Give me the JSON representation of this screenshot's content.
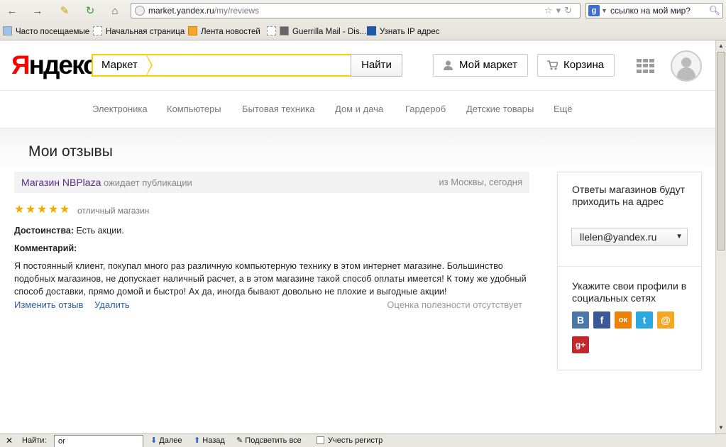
{
  "browser": {
    "url_host": "market.yandex.ru",
    "url_path": "/my/reviews",
    "search_value": "ссылко на мой мир?",
    "search_engine_icon": "google-icon",
    "bookmarks": [
      {
        "label": "Часто посещаемые",
        "icon": "search-icon"
      },
      {
        "label": "Начальная страница",
        "icon": "page-icon"
      },
      {
        "label": "Лента новостей",
        "icon": "rss-icon"
      },
      {
        "label": "Guerrilla Mail - Dis...",
        "icon": "page-icon"
      },
      {
        "label": "Узнать IP адрес",
        "icon": "ip-icon"
      }
    ]
  },
  "header": {
    "logo_first": "Я",
    "logo_rest": "ндекс",
    "search_tag": "Маркет",
    "search_button": "Найти",
    "my_market": "Мой маркет",
    "cart": "Корзина"
  },
  "categories": [
    "Электроника",
    "Компьютеры",
    "Бытовая техника",
    "Дом и дача",
    "Гардероб",
    "Детские товары",
    "Ещё"
  ],
  "page": {
    "title": "Мои отзывы"
  },
  "review": {
    "shop": "Магазин NBPlaza",
    "status": "ожидает публикации",
    "location_time": "из Москвы, сегодня",
    "rating": 5,
    "rating_max": 5,
    "rating_text": "отличный магазин",
    "pros_label": "Достоинства:",
    "pros": "Есть акции.",
    "comment_label": "Комментарий:",
    "comment": "Я постоянный клиент, покупал много раз различную компьютерную технику в этом интернет магазине. Большинство подобных магазинов, не допускает наличный расчет, а в этом магазине такой способ оплаты имеется! К тому же удобный способ доставки, прямо домой и быстро! Ах да, иногда бывают довольно не плохие и выгодные акции!",
    "edit": "Изменить отзыв",
    "delete": "Удалить",
    "usefulness": "Оценка полезности отсутствует"
  },
  "sidebar": {
    "answers_text": "Ответы магазинов будут приходить на адрес",
    "email": "llelen@yandex.ru",
    "social_text": "Укажите свои профили в социальных сетях",
    "socials": [
      {
        "label": "В",
        "color": "#4a76a8"
      },
      {
        "label": "f",
        "color": "#3b5998"
      },
      {
        "label": "ок",
        "color": "#ee8208"
      },
      {
        "label": "t",
        "color": "#2ca7e0"
      },
      {
        "label": "@",
        "color": "#f5a623"
      },
      {
        "label": "g+",
        "color": "#c1272d"
      }
    ]
  },
  "findbar": {
    "label": "Найти:",
    "value": "or",
    "next": "Далее",
    "prev": "Назад",
    "highlight": "Подсветить все",
    "match_case": "Учесть регистр"
  }
}
